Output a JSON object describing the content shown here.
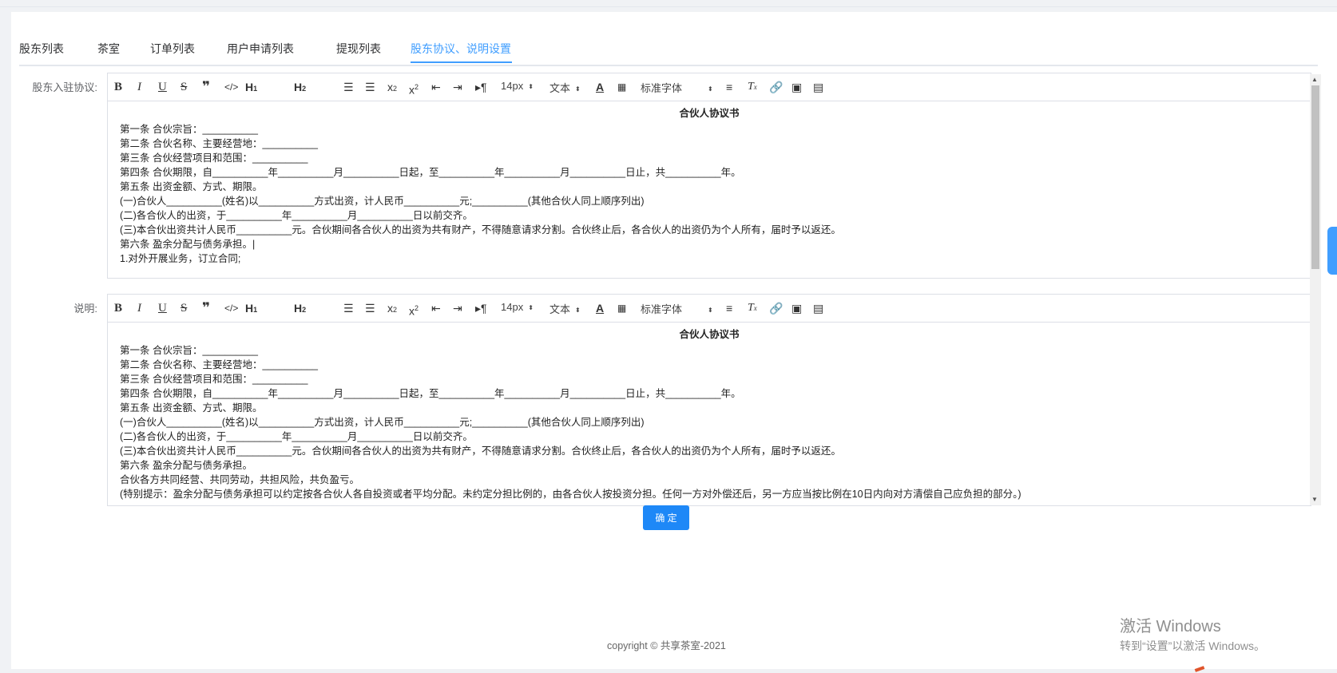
{
  "tabs": [
    {
      "label": "股东列表"
    },
    {
      "label": "茶室"
    },
    {
      "label": "订单列表"
    },
    {
      "label": "用户申请列表"
    },
    {
      "label": "提现列表"
    },
    {
      "label": "股东协议、说明设置"
    }
  ],
  "form": {
    "agreement_label": "股东入驻协议:",
    "description_label": "说明:"
  },
  "toolbar": {
    "font_size": "14px",
    "text_type": "文本",
    "font_family": "标准字体",
    "buttons": [
      "bold-icon",
      "italic-icon",
      "underline-icon",
      "strike-icon",
      "quote-icon",
      "code-icon",
      "h1-icon",
      "h2-icon",
      "ordered-list-icon",
      "bullet-list-icon",
      "subscript-icon",
      "superscript-icon",
      "outdent-icon",
      "indent-icon",
      "rtl-icon",
      "font-color-icon",
      "background-color-icon",
      "align-icon",
      "clean-format-icon",
      "link-icon",
      "image-icon",
      "video-icon"
    ]
  },
  "editor1": {
    "title": "合伙人协议书",
    "lines": [
      "第一条 合伙宗旨：__________",
      "第二条 合伙名称、主要经营地：__________",
      "第三条 合伙经营项目和范围：__________",
      "第四条 合伙期限，自__________年__________月__________日起，至__________年__________月__________日止，共__________年。",
      "第五条 出资金额、方式、期限。",
      "(一)合伙人__________(姓名)以__________方式出资，计人民币__________元;__________(其他合伙人同上顺序列出)",
      "(二)各合伙人的出资，于__________年__________月__________日以前交齐。",
      "(三)本合伙出资共计人民币__________元。合伙期间各合伙人的出资为共有财产，不得随意请求分割。合伙终止后，各合伙人的出资仍为个人所有，届时予以返还。",
      "第六条 盈余分配与债务承担。|",
      "1.对外开展业务，订立合同;"
    ]
  },
  "editor2": {
    "title": "合伙人协议书",
    "lines": [
      "第一条 合伙宗旨：__________",
      "第二条 合伙名称、主要经营地：__________",
      "第三条 合伙经营项目和范围：__________",
      "第四条 合伙期限，自__________年__________月__________日起，至__________年__________月__________日止，共__________年。",
      "第五条 出资金额、方式、期限。",
      "(一)合伙人__________(姓名)以__________方式出资，计人民币__________元;__________(其他合伙人同上顺序列出)",
      "(二)各合伙人的出资，于__________年__________月__________日以前交齐。",
      "(三)本合伙出资共计人民币__________元。合伙期间各合伙人的出资为共有财产，不得随意请求分割。合伙终止后，各合伙人的出资仍为个人所有，届时予以返还。",
      "第六条 盈余分配与债务承担。",
      "合伙各方共同经营、共同劳动，共担风险，共负盈亏。",
      "(特别提示：盈余分配与债务承担可以约定按各合伙人各自投资或者平均分配。未约定分担比例的，由各合伙人按投资分担。任何一方对外偿还后，另一方应当按比例在10日内向对方清偿自己应负担的部分。)"
    ]
  },
  "confirm_label": "确 定",
  "footer": "copyright © 共享茶室-2021",
  "watermark": {
    "line1": "激活 Windows",
    "line2": "转到“设置”以激活 Windows。"
  },
  "colors": {
    "accent": "#409eff",
    "button": "#1e88f7"
  }
}
